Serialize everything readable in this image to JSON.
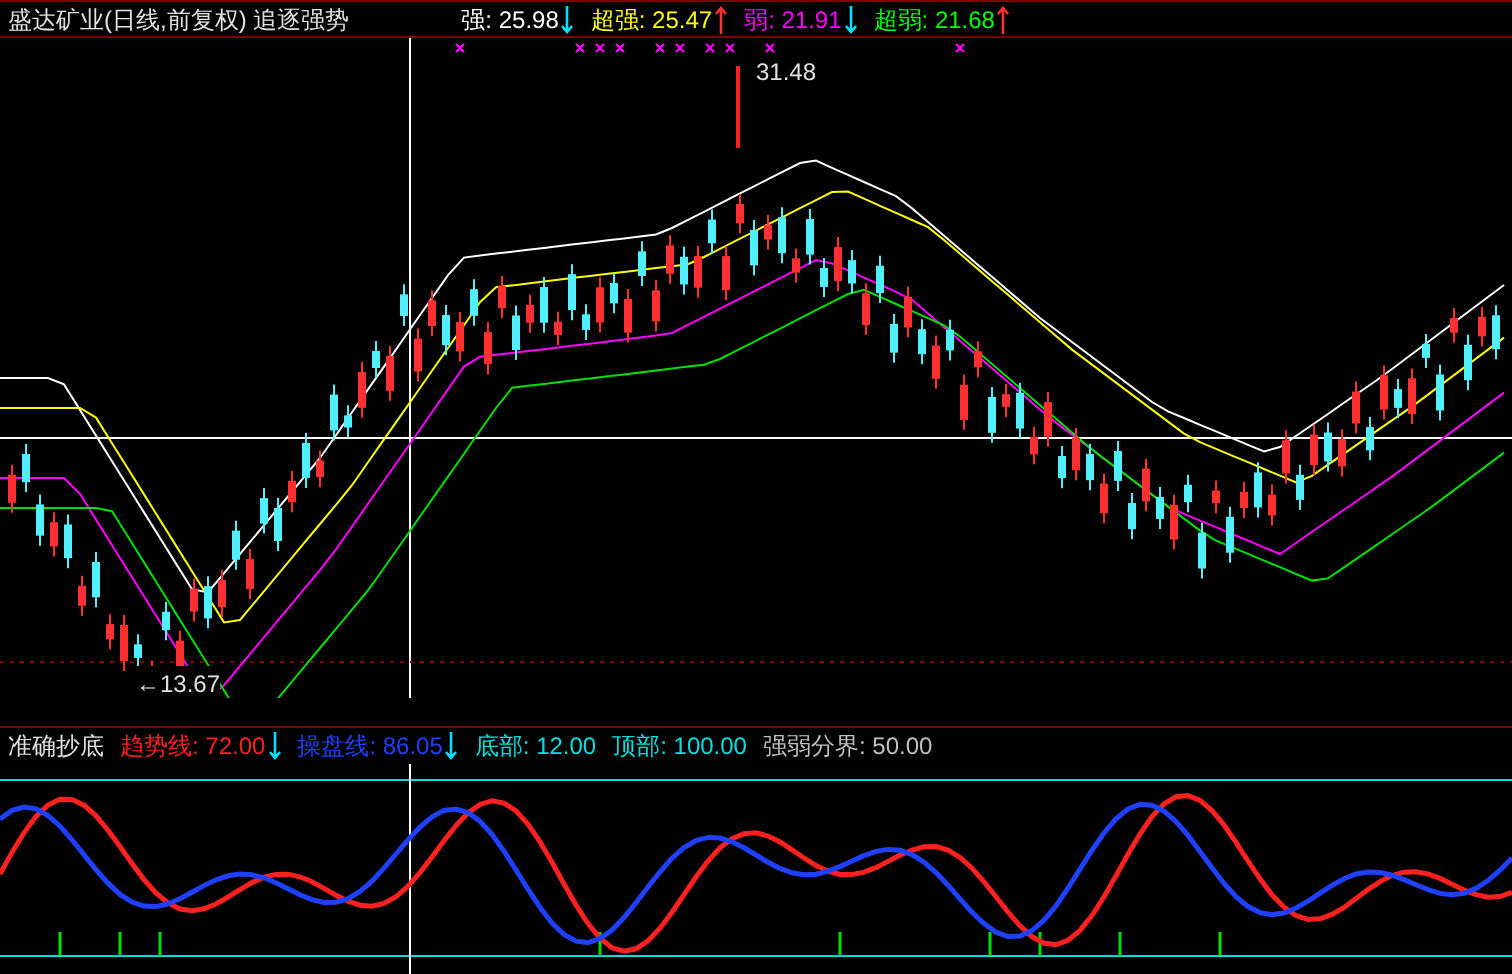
{
  "chart_title": "盛达矿业(日线,前复权) 追逐强势",
  "price_legend": [
    {
      "label": "强: 25.98",
      "color": "#ffffff",
      "kind": "down"
    },
    {
      "label": "超强: 25.47",
      "color": "#ffff00",
      "kind": "up"
    },
    {
      "label": "弱: 21.91",
      "color": "#ff00ff",
      "kind": "down"
    },
    {
      "label": "超弱: 21.68",
      "color": "#00ff00",
      "kind": "up"
    }
  ],
  "high_label": "31.48",
  "low_label": "←13.67",
  "indicator_title": "准确抄底",
  "indicator_legend": [
    {
      "label": "趋势线: 72.00",
      "color": "#ff2020",
      "kind": "down"
    },
    {
      "label": "操盘线: 86.05",
      "color": "#2040ff",
      "kind": "down"
    },
    {
      "label": "底部: 12.00",
      "color": "#00e0e0",
      "kind": "none"
    },
    {
      "label": "顶部: 100.00",
      "color": "#00e0e0",
      "kind": "none"
    },
    {
      "label": "强弱分界: 50.00",
      "color": "#c0c0c0",
      "kind": "none"
    }
  ]
}
